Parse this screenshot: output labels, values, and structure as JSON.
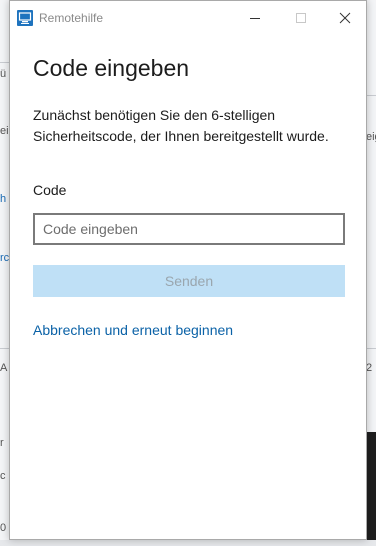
{
  "window": {
    "title": "Remotehilfe",
    "icon": "remote-assistance-icon",
    "controls": {
      "minimize_icon": "minimize-icon",
      "maximize_icon": "maximize-icon",
      "close_icon": "close-icon"
    }
  },
  "main": {
    "heading": "Code eingeben",
    "description": "Zunächst benötigen Sie den 6-stelligen Sicherheitscode, der Ihnen bereitgestellt wurde.",
    "code_label": "Code",
    "code_input": {
      "value": "",
      "placeholder": "Code eingeben"
    },
    "send_button": "Senden",
    "restart_link": "Abbrechen und erneut beginnen"
  },
  "colors": {
    "accent": "#0b62a7",
    "send_button_bg": "#bfe0f6",
    "send_button_text": "#9aa6ae"
  },
  "background_fragments": {
    "left": [
      "ü",
      "ei",
      "h",
      "rc",
      "A",
      "r",
      "c",
      "0"
    ],
    "right": [
      "eig",
      "2"
    ]
  }
}
